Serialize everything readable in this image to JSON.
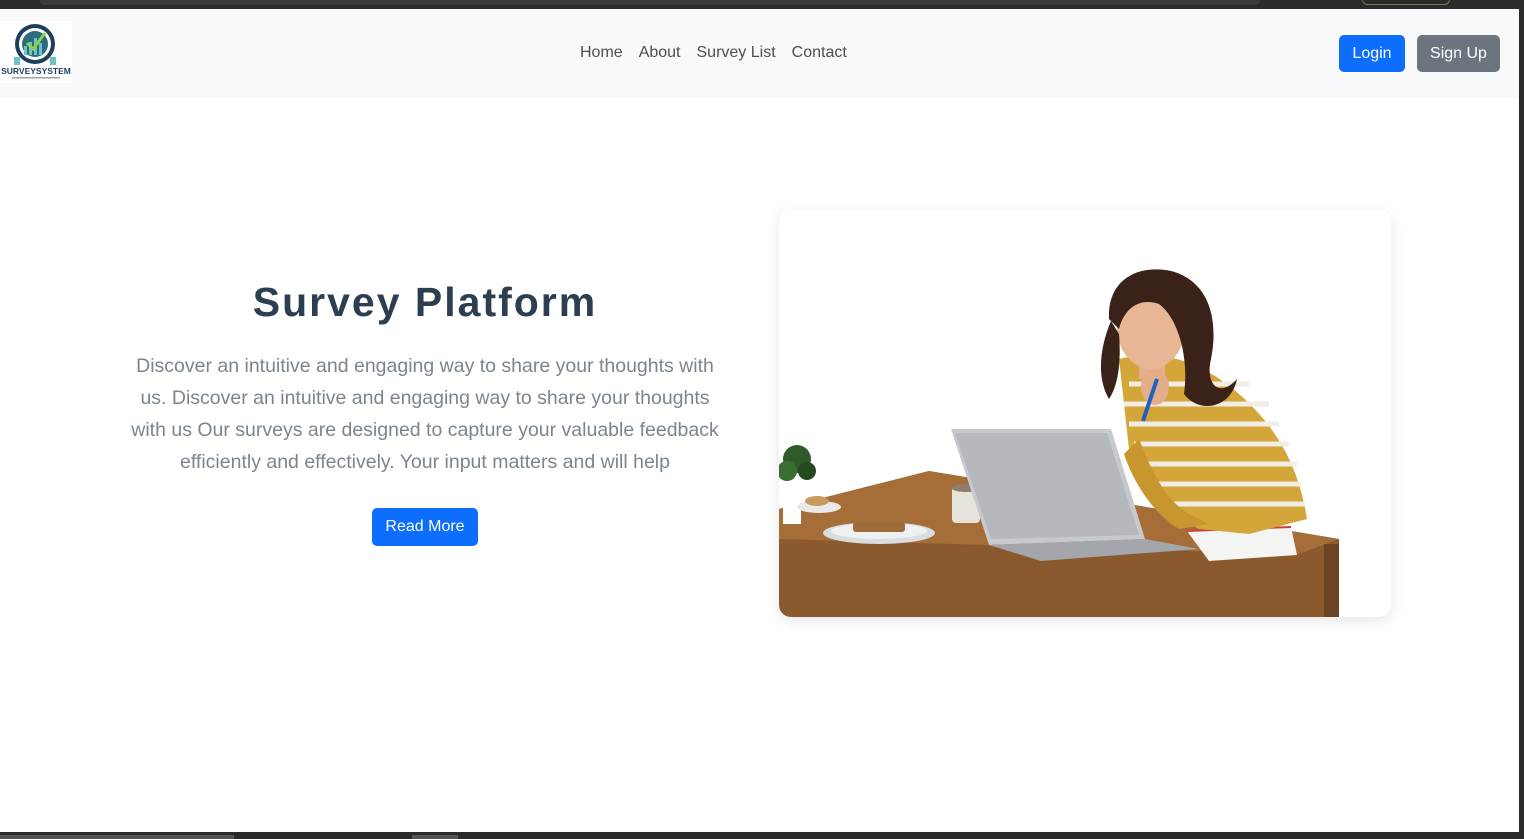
{
  "brand": {
    "logo_text": "SURVEYSYSTEM"
  },
  "nav": {
    "links": [
      {
        "label": "Home"
      },
      {
        "label": "About"
      },
      {
        "label": "Survey List"
      },
      {
        "label": "Contact"
      }
    ],
    "login_label": "Login",
    "signup_label": "Sign Up"
  },
  "hero": {
    "title": "Survey Platform",
    "text": "Discover an intuitive and engaging way to share your thoughts with us. Discover an intuitive and engaging way to share your thoughts with us Our surveys are designed to capture your valuable feedback efficiently and effectively. Your input matters and will help",
    "cta_label": "Read More"
  },
  "colors": {
    "primary": "#0d6efd",
    "secondary": "#6c757d",
    "navbar_bg": "#f8f9fa",
    "title": "#2c3e50"
  },
  "icons": [
    "survey-logo-icon",
    "woman-laptop-illustration"
  ]
}
